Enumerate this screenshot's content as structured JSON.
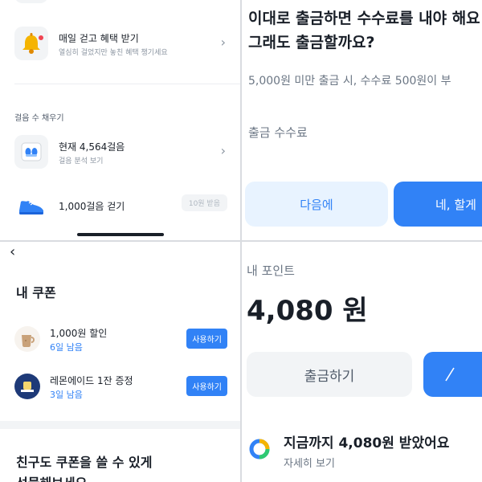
{
  "top_left": {
    "walk_benefit": {
      "title": "매일 걷고 혜택 받기",
      "subtitle": "열심히 걸었지만 놓친 혜택 챙기세요"
    },
    "section_title": "걸음 수 채우기",
    "steps_now": {
      "title": "현재 4,564걸음",
      "subtitle": "걸음 분석 보기"
    },
    "walk_1000": {
      "title": "1,000걸음 걷기",
      "reward": "10원 받음"
    }
  },
  "top_right": {
    "title_line1": "이대로 출금하면 수수료를 내야 해요",
    "title_line2": "그래도 출금할까요?",
    "description": "5,000원 미만 출금 시, 수수료 500원이 부",
    "fee_label": "출금 수수료",
    "later_button": "다음에",
    "confirm_button": "네, 할게"
  },
  "bottom_left": {
    "title": "내 쿠폰",
    "coupons": [
      {
        "name": "1,000원 할인",
        "remaining": "6일 남음",
        "action": "사용하기"
      },
      {
        "name": "레몬에이드 1잔 증정",
        "remaining": "3일 남음",
        "action": "사용하기"
      }
    ],
    "share_line1": "친구도 쿠폰을 쓸 수 있게",
    "share_line2": "선물해보세요"
  },
  "bottom_right": {
    "label": "내 포인트",
    "amount": "4,080 원",
    "withdraw_button": "출금하기",
    "total_received": "지금까지 4,080원 받았어요",
    "detail_link": "자세히 보기"
  },
  "colors": {
    "accent": "#3182f6",
    "light_accent": "#e8f3ff",
    "text": "#191f28",
    "muted": "#6b7684"
  }
}
